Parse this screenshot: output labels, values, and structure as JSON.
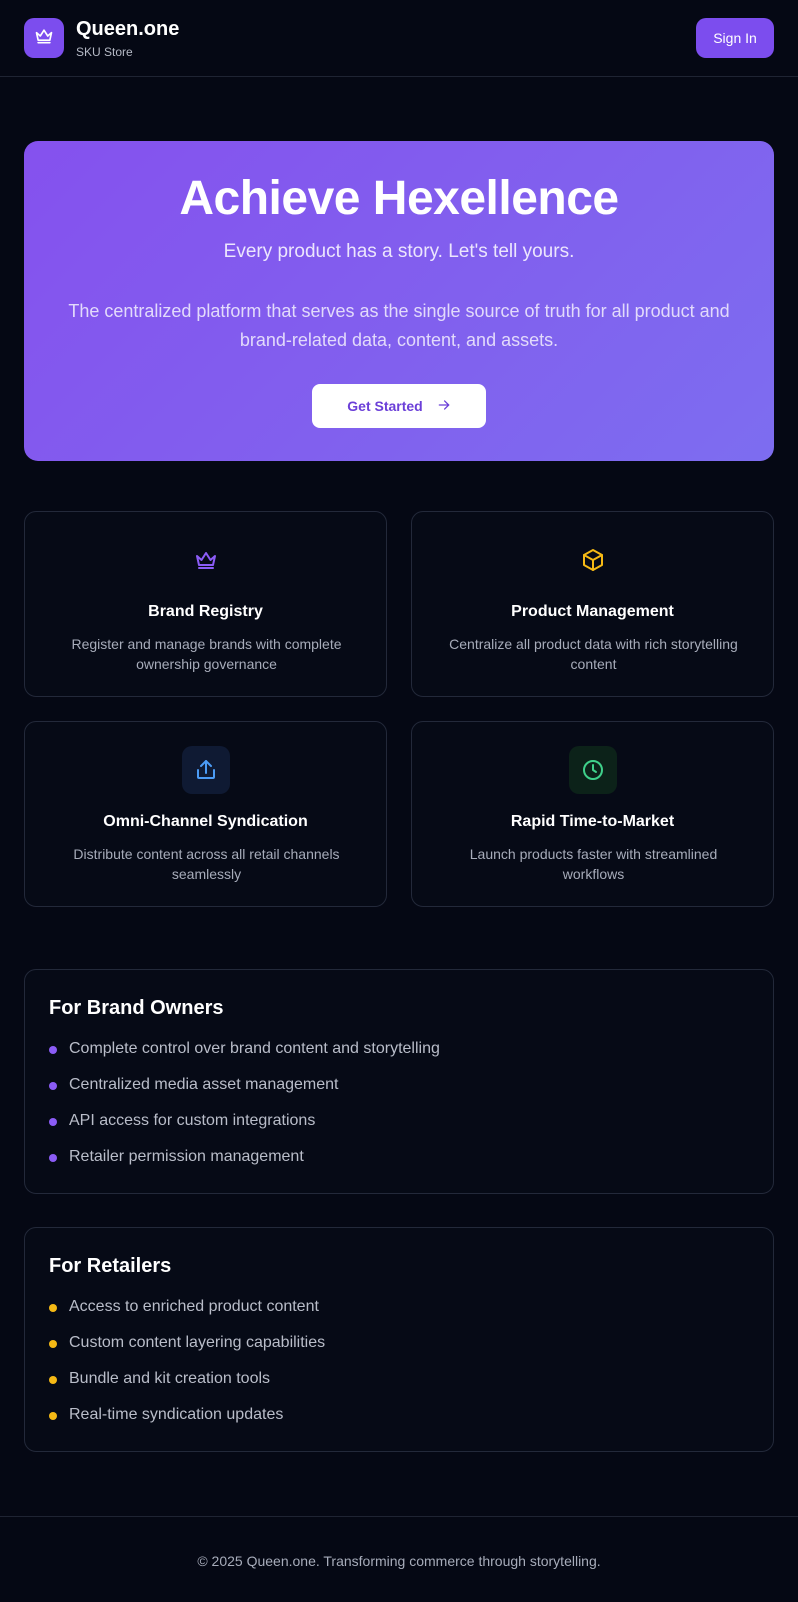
{
  "header": {
    "logo_icon": "crown-icon",
    "brand_name": "Queen.one",
    "brand_sub": "SKU Store",
    "signin_label": "Sign In"
  },
  "hero": {
    "title": "Achieve Hexellence",
    "tagline": "Every product has a story. Let's tell yours.",
    "description": "The centralized platform that serves as the single source of truth for all product and brand-related data, content, and assets.",
    "cta_label": "Get Started",
    "cta_icon": "arrow-right-icon"
  },
  "features": [
    {
      "icon": "crown-icon",
      "title": "Brand Registry",
      "description": "Register and manage brands with complete ownership governance",
      "color": "#8b5cf6"
    },
    {
      "icon": "box-icon",
      "title": "Product Management",
      "description": "Centralize all product data with rich storytelling content",
      "color": "#f5b915"
    },
    {
      "icon": "share-icon",
      "title": "Omni-Channel Syndication",
      "description": "Distribute content across all retail channels seamlessly",
      "color": "#4b9bf5"
    },
    {
      "icon": "clock-icon",
      "title": "Rapid Time-to-Market",
      "description": "Launch products faster with streamlined workflows",
      "color": "#3fd08a"
    }
  ],
  "brand_owners": {
    "title": "For Brand Owners",
    "bullet_color": "#8b5cf6",
    "items": [
      "Complete control over brand content and storytelling",
      "Centralized media asset management",
      "API access for custom integrations",
      "Retailer permission management"
    ]
  },
  "retailers": {
    "title": "For Retailers",
    "bullet_color": "#f5b915",
    "items": [
      "Access to enriched product content",
      "Custom content layering capabilities",
      "Bundle and kit creation tools",
      "Real-time syndication updates"
    ]
  },
  "footer": {
    "text": "© 2025 Queen.one. Transforming commerce through storytelling."
  }
}
